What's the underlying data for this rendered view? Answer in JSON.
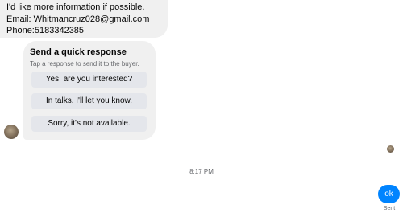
{
  "incoming_message": {
    "lines": [
      "I'd like more information if possible.",
      "Email: Whitmancruz028@gmail.com",
      "Phone:5183342385"
    ]
  },
  "quick_response": {
    "title": "Send a quick response",
    "subtitle": "Tap a response to send it to the buyer.",
    "options": [
      "Yes, are you interested?",
      "In talks. I'll let you know.",
      "Sorry, it's not available."
    ]
  },
  "timestamp": "8:17 PM",
  "outgoing_message": {
    "text": "ok",
    "status": "Sent",
    "bubble_color": "#0084ff"
  }
}
